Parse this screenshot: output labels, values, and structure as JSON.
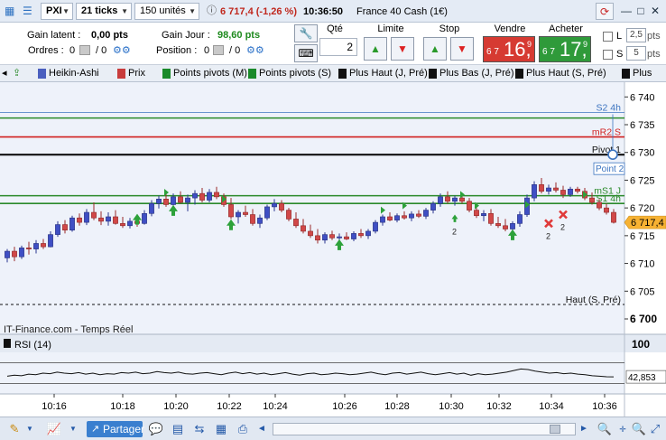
{
  "toolbar": {
    "symbol_input": "PXI",
    "interval_select": "21 ticks",
    "units_select": "150 unités",
    "quote_change": "6 717,4 (-1,26 %)",
    "quote_time": "10:36:50",
    "instrument_name": "France 40 Cash (1€)",
    "minimize": "—",
    "maximize": "□",
    "close": "✕"
  },
  "info": {
    "gain_latent_label": "Gain latent :",
    "gain_latent_value": "0,00 pts",
    "ordres_label": "Ordres :",
    "ordres_count": "0",
    "ordres_pending": "/ 0",
    "gain_jour_label": "Gain Jour :",
    "gain_jour_value": "98,60 pts",
    "position_label": "Position :",
    "position_value": "0",
    "position_pending": "/ 0",
    "qte_label": "Qté",
    "qte_value": "2",
    "limite_label": "Limite",
    "stop_label": "Stop",
    "vendre_label": "Vendre",
    "vendre_small": "6 7",
    "vendre_big": "16,",
    "vendre_sup": "9",
    "acheter_label": "Acheter",
    "acheter_small": "6 7",
    "acheter_big": "17,",
    "acheter_sup": "9",
    "l_label": "L",
    "l_value": "2,5",
    "l_unit": "pts",
    "s_label": "S",
    "s_value": "5",
    "s_unit": "pts",
    "sell_color": "#d63a32",
    "buy_color": "#2f9a3a"
  },
  "indicators": [
    {
      "label": "Heikin-Ashi",
      "color": "#4a5fbf"
    },
    {
      "label": "Prix",
      "color": "#c83c3c"
    },
    {
      "label": "Points pivots (M)",
      "color": "#1a8a2a"
    },
    {
      "label": "Points pivots (S)",
      "color": "#1a8a2a"
    },
    {
      "label": "Plus Haut (J, Pré)",
      "color": "#111111"
    },
    {
      "label": "Plus Bas (J, Pré)",
      "color": "#111111"
    },
    {
      "label": "Plus Haut (S, Pré)",
      "color": "#111111"
    },
    {
      "label": "Plus",
      "color": "#111111"
    }
  ],
  "chart_data": [
    {
      "type": "candlestick",
      "yticks": [
        "6 740",
        "6 735",
        "6 730",
        "6 725",
        "6 720",
        "6 715",
        "6 710",
        "6 705",
        "6 700"
      ],
      "ylim": [
        6700,
        6742
      ],
      "xticks": [
        "10:16",
        "10:18",
        "10:20",
        "10:22",
        "10:24",
        "10:26",
        "10:28",
        "10:30",
        "10:32",
        "10:34",
        "10:36"
      ],
      "last_price_label": "6 717,4",
      "last_price": 6717.4,
      "source_label": "IT-Finance.com - Temps Réel",
      "levels": [
        {
          "label": "S2 4h",
          "value": 6737.2,
          "color": "#3c74c0",
          "style": "thin"
        },
        {
          "label": "",
          "value": 6736.2,
          "color": "#2a8a2a",
          "style": "solid"
        },
        {
          "label": "mR2 S",
          "value": 6732.8,
          "color": "#d12020",
          "style": "solid"
        },
        {
          "label": "Pivot 1",
          "value": 6729.6,
          "color": "#111111",
          "style": "thick"
        },
        {
          "label": "mS1 J",
          "value": 6722.2,
          "color": "#2a8a2a",
          "style": "solid"
        },
        {
          "label": "S1 4h",
          "value": 6720.8,
          "color": "#2a8a2a",
          "style": "solid"
        },
        {
          "label": "Haut (S, Pré)",
          "value": 6702.6,
          "color": "#111111",
          "style": "dashed"
        }
      ],
      "drag_tooltip": "Point 2",
      "candles": [
        {
          "o": 6711.0,
          "h": 6712.6,
          "l": 6710.2,
          "c": 6712.2
        },
        {
          "o": 6712.2,
          "h": 6713.0,
          "l": 6710.4,
          "c": 6711.2
        },
        {
          "o": 6711.2,
          "h": 6713.2,
          "l": 6710.8,
          "c": 6712.8
        },
        {
          "o": 6712.8,
          "h": 6713.9,
          "l": 6711.6,
          "c": 6712.6
        },
        {
          "o": 6712.6,
          "h": 6714.2,
          "l": 6711.8,
          "c": 6713.6
        },
        {
          "o": 6713.6,
          "h": 6714.4,
          "l": 6712.6,
          "c": 6713.0
        },
        {
          "o": 6713.0,
          "h": 6715.8,
          "l": 6712.9,
          "c": 6715.2
        },
        {
          "o": 6715.2,
          "h": 6717.6,
          "l": 6714.8,
          "c": 6717.0
        },
        {
          "o": 6717.0,
          "h": 6717.8,
          "l": 6715.4,
          "c": 6716.0
        },
        {
          "o": 6716.0,
          "h": 6718.6,
          "l": 6715.7,
          "c": 6718.2
        },
        {
          "o": 6718.2,
          "h": 6719.0,
          "l": 6716.8,
          "c": 6717.4
        },
        {
          "o": 6717.4,
          "h": 6719.8,
          "l": 6716.9,
          "c": 6719.2
        },
        {
          "o": 6719.2,
          "h": 6721.0,
          "l": 6717.8,
          "c": 6718.2
        },
        {
          "o": 6718.2,
          "h": 6719.4,
          "l": 6716.9,
          "c": 6717.6
        },
        {
          "o": 6717.6,
          "h": 6719.2,
          "l": 6716.8,
          "c": 6718.4
        },
        {
          "o": 6718.4,
          "h": 6719.6,
          "l": 6717.0,
          "c": 6717.2
        },
        {
          "o": 6717.2,
          "h": 6718.4,
          "l": 6716.4,
          "c": 6716.8
        },
        {
          "o": 6716.8,
          "h": 6718.2,
          "l": 6716.3,
          "c": 6717.6
        },
        {
          "o": 6717.6,
          "h": 6718.8,
          "l": 6716.6,
          "c": 6717.2
        },
        {
          "o": 6717.2,
          "h": 6719.6,
          "l": 6717.0,
          "c": 6719.0
        },
        {
          "o": 6719.0,
          "h": 6721.4,
          "l": 6718.5,
          "c": 6720.8
        },
        {
          "o": 6720.8,
          "h": 6722.2,
          "l": 6719.9,
          "c": 6721.6
        },
        {
          "o": 6721.6,
          "h": 6722.8,
          "l": 6720.2,
          "c": 6720.6
        },
        {
          "o": 6720.6,
          "h": 6722.6,
          "l": 6719.8,
          "c": 6722.0
        },
        {
          "o": 6722.0,
          "h": 6723.0,
          "l": 6720.8,
          "c": 6721.0
        },
        {
          "o": 6721.0,
          "h": 6722.4,
          "l": 6719.4,
          "c": 6721.8
        },
        {
          "o": 6721.8,
          "h": 6723.2,
          "l": 6720.6,
          "c": 6722.6
        },
        {
          "o": 6722.6,
          "h": 6723.6,
          "l": 6721.0,
          "c": 6721.4
        },
        {
          "o": 6721.4,
          "h": 6723.4,
          "l": 6721.0,
          "c": 6722.8
        },
        {
          "o": 6722.8,
          "h": 6723.8,
          "l": 6721.6,
          "c": 6722.0
        },
        {
          "o": 6722.0,
          "h": 6722.6,
          "l": 6720.2,
          "c": 6720.6
        },
        {
          "o": 6720.6,
          "h": 6721.8,
          "l": 6718.0,
          "c": 6718.4
        },
        {
          "o": 6718.4,
          "h": 6719.6,
          "l": 6717.2,
          "c": 6719.2
        },
        {
          "o": 6719.2,
          "h": 6720.4,
          "l": 6718.4,
          "c": 6718.8
        },
        {
          "o": 6718.8,
          "h": 6719.8,
          "l": 6716.8,
          "c": 6717.2
        },
        {
          "o": 6717.2,
          "h": 6718.8,
          "l": 6716.4,
          "c": 6718.2
        },
        {
          "o": 6718.2,
          "h": 6720.6,
          "l": 6717.8,
          "c": 6720.2
        },
        {
          "o": 6720.2,
          "h": 6721.6,
          "l": 6719.4,
          "c": 6720.8
        },
        {
          "o": 6720.8,
          "h": 6721.4,
          "l": 6719.2,
          "c": 6719.6
        },
        {
          "o": 6719.6,
          "h": 6720.0,
          "l": 6717.6,
          "c": 6718.0
        },
        {
          "o": 6718.0,
          "h": 6719.2,
          "l": 6716.4,
          "c": 6716.8
        },
        {
          "o": 6716.8,
          "h": 6718.0,
          "l": 6715.4,
          "c": 6715.8
        },
        {
          "o": 6715.8,
          "h": 6717.0,
          "l": 6714.6,
          "c": 6715.0
        },
        {
          "o": 6715.0,
          "h": 6716.2,
          "l": 6713.6,
          "c": 6714.2
        },
        {
          "o": 6714.2,
          "h": 6715.6,
          "l": 6713.6,
          "c": 6715.2
        },
        {
          "o": 6715.2,
          "h": 6715.9,
          "l": 6714.2,
          "c": 6714.6
        },
        {
          "o": 6714.6,
          "h": 6715.4,
          "l": 6714.0,
          "c": 6714.8
        },
        {
          "o": 6714.8,
          "h": 6715.6,
          "l": 6714.2,
          "c": 6714.4
        },
        {
          "o": 6714.4,
          "h": 6715.8,
          "l": 6714.0,
          "c": 6715.4
        },
        {
          "o": 6715.4,
          "h": 6716.2,
          "l": 6714.6,
          "c": 6715.0
        },
        {
          "o": 6715.0,
          "h": 6716.2,
          "l": 6714.4,
          "c": 6715.8
        },
        {
          "o": 6715.8,
          "h": 6717.8,
          "l": 6715.4,
          "c": 6717.4
        },
        {
          "o": 6717.4,
          "h": 6718.8,
          "l": 6716.8,
          "c": 6718.4
        },
        {
          "o": 6718.4,
          "h": 6719.2,
          "l": 6717.6,
          "c": 6717.8
        },
        {
          "o": 6717.8,
          "h": 6719.0,
          "l": 6717.4,
          "c": 6718.6
        },
        {
          "o": 6718.6,
          "h": 6719.4,
          "l": 6717.9,
          "c": 6718.2
        },
        {
          "o": 6718.2,
          "h": 6719.4,
          "l": 6717.6,
          "c": 6718.9
        },
        {
          "o": 6718.9,
          "h": 6719.6,
          "l": 6718.2,
          "c": 6718.5
        },
        {
          "o": 6718.5,
          "h": 6720.0,
          "l": 6718.0,
          "c": 6719.6
        },
        {
          "o": 6719.6,
          "h": 6721.2,
          "l": 6719.0,
          "c": 6720.8
        },
        {
          "o": 6720.8,
          "h": 6722.6,
          "l": 6720.2,
          "c": 6722.0
        },
        {
          "o": 6722.0,
          "h": 6723.0,
          "l": 6720.8,
          "c": 6721.2
        },
        {
          "o": 6721.2,
          "h": 6722.2,
          "l": 6720.4,
          "c": 6721.8
        },
        {
          "o": 6721.8,
          "h": 6722.4,
          "l": 6720.8,
          "c": 6721.2
        },
        {
          "o": 6721.2,
          "h": 6721.8,
          "l": 6719.2,
          "c": 6719.6
        },
        {
          "o": 6719.6,
          "h": 6720.8,
          "l": 6718.2,
          "c": 6718.6
        },
        {
          "o": 6718.6,
          "h": 6719.6,
          "l": 6717.6,
          "c": 6719.0
        },
        {
          "o": 6719.0,
          "h": 6719.8,
          "l": 6716.8,
          "c": 6717.2
        },
        {
          "o": 6717.2,
          "h": 6718.4,
          "l": 6716.4,
          "c": 6716.8
        },
        {
          "o": 6716.8,
          "h": 6718.0,
          "l": 6715.8,
          "c": 6716.2
        },
        {
          "o": 6716.2,
          "h": 6717.6,
          "l": 6715.2,
          "c": 6717.2
        },
        {
          "o": 6717.2,
          "h": 6719.4,
          "l": 6716.6,
          "c": 6718.8
        },
        {
          "o": 6718.8,
          "h": 6722.4,
          "l": 6718.4,
          "c": 6721.8
        },
        {
          "o": 6721.8,
          "h": 6724.8,
          "l": 6721.2,
          "c": 6724.2
        },
        {
          "o": 6724.2,
          "h": 6725.4,
          "l": 6722.6,
          "c": 6723.0
        },
        {
          "o": 6723.0,
          "h": 6724.2,
          "l": 6722.4,
          "c": 6723.6
        },
        {
          "o": 6723.6,
          "h": 6724.6,
          "l": 6722.8,
          "c": 6723.2
        },
        {
          "o": 6723.2,
          "h": 6724.0,
          "l": 6721.8,
          "c": 6722.4
        },
        {
          "o": 6722.4,
          "h": 6723.8,
          "l": 6722.0,
          "c": 6723.4
        },
        {
          "o": 6723.4,
          "h": 6723.8,
          "l": 6722.6,
          "c": 6723.0
        },
        {
          "o": 6723.0,
          "h": 6723.6,
          "l": 6721.4,
          "c": 6721.8
        },
        {
          "o": 6721.8,
          "h": 6722.8,
          "l": 6720.6,
          "c": 6721.0
        },
        {
          "o": 6721.0,
          "h": 6721.6,
          "l": 6719.6,
          "c": 6720.0
        },
        {
          "o": 6720.0,
          "h": 6720.8,
          "l": 6718.8,
          "c": 6719.2
        },
        {
          "o": 6719.2,
          "h": 6719.8,
          "l": 6717.2,
          "c": 6717.4
        }
      ],
      "signals": [
        {
          "i": 18,
          "type": "up",
          "price": 6717.8
        },
        {
          "i": 23,
          "type": "up",
          "price": 6719.4
        },
        {
          "i": 22,
          "type": "tri",
          "price": 6722.8
        },
        {
          "i": 31,
          "type": "up",
          "price": 6716.8
        },
        {
          "i": 30,
          "type": "tri",
          "price": 6721.6
        },
        {
          "i": 46,
          "type": "up",
          "price": 6713.2
        },
        {
          "i": 52,
          "type": "tri",
          "price": 6719.6
        },
        {
          "i": 55,
          "type": "tri",
          "price": 6720.4
        },
        {
          "i": 62,
          "type": "upsmall",
          "price": 6718.0,
          "label": "2"
        },
        {
          "i": 63,
          "type": "tri",
          "price": 6722.4
        },
        {
          "i": 65,
          "type": "tri",
          "price": 6720.4
        },
        {
          "i": 70,
          "type": "up",
          "price": 6715.0,
          "label": ""
        },
        {
          "i": 72,
          "type": "tri",
          "price": 6720.6
        },
        {
          "i": 75,
          "type": "x",
          "price": 6717.2,
          "label": "2"
        },
        {
          "i": 77,
          "type": "x",
          "price": 6718.8,
          "label": "2"
        },
        {
          "i": 80,
          "type": "tri",
          "price": 6722.4
        }
      ]
    },
    {
      "type": "line",
      "title": "RSI (14)",
      "ytick_top": "100",
      "last_value_label": "42,853",
      "ylim": [
        0,
        100
      ],
      "values": [
        44,
        46,
        45,
        48,
        47,
        50,
        49,
        52,
        50,
        49,
        51,
        48,
        50,
        47,
        49,
        48,
        51,
        50,
        52,
        49,
        50,
        53,
        51,
        50,
        52,
        49,
        48,
        50,
        51,
        49,
        47,
        50,
        52,
        49,
        51,
        48,
        50,
        47,
        49,
        51,
        48,
        46,
        49,
        50,
        47,
        48,
        50,
        49,
        47,
        48,
        50,
        52,
        49,
        47,
        50,
        51,
        48,
        50,
        52,
        49,
        47,
        49,
        51,
        48,
        50,
        46,
        49,
        47,
        48,
        50,
        52,
        55,
        58,
        57,
        54,
        52,
        50,
        51,
        49,
        50,
        48,
        47,
        45,
        44,
        43,
        42.853
      ],
      "last_value": 42.853
    }
  ],
  "bottom": {
    "share_label": "Partager",
    "scroll_left": "◄",
    "scroll_right": "►"
  }
}
